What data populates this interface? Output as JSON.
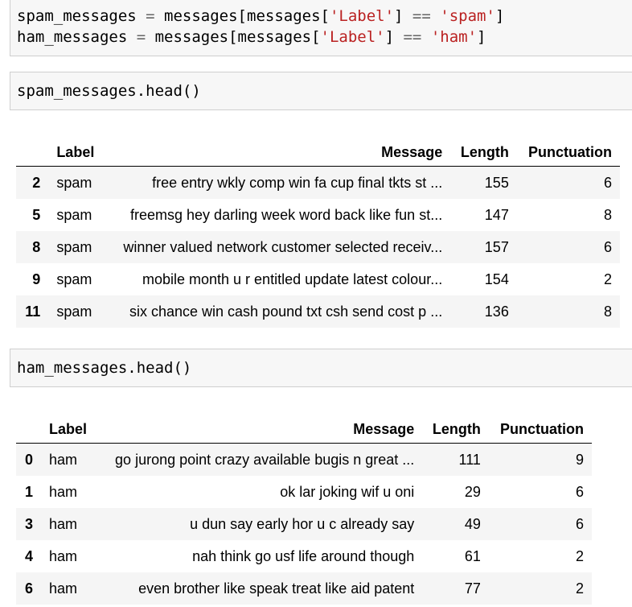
{
  "cells": [
    {
      "lines": [
        [
          [
            "spam_messages ",
            ""
          ],
          [
            "=",
            "o"
          ],
          [
            " messages[messages[",
            ""
          ],
          [
            "'Label'",
            "s"
          ],
          [
            "] ",
            ""
          ],
          [
            "==",
            "o"
          ],
          [
            " ",
            ""
          ],
          [
            "'spam'",
            "s"
          ],
          [
            "]",
            ""
          ]
        ],
        [
          [
            "ham_messages ",
            ""
          ],
          [
            "=",
            "o"
          ],
          [
            " messages[messages[",
            ""
          ],
          [
            "'Label'",
            "s"
          ],
          [
            "] ",
            ""
          ],
          [
            "==",
            "o"
          ],
          [
            " ",
            ""
          ],
          [
            "'ham'",
            "s"
          ],
          [
            "]",
            ""
          ]
        ]
      ]
    },
    {
      "lines": [
        [
          [
            "spam_messages.head()",
            ""
          ]
        ]
      ]
    },
    {
      "lines": [
        [
          [
            "ham_messages.head()",
            ""
          ]
        ]
      ]
    }
  ],
  "spam_table": {
    "columns": [
      "",
      "Label",
      "Message",
      "Length",
      "Punctuation"
    ],
    "rows": [
      [
        "2",
        "spam",
        "free entry wkly comp win fa cup final tkts st ...",
        "155",
        "6"
      ],
      [
        "5",
        "spam",
        "freemsg hey darling week word back like fun st...",
        "147",
        "8"
      ],
      [
        "8",
        "spam",
        "winner valued network customer selected receiv...",
        "157",
        "6"
      ],
      [
        "9",
        "spam",
        "mobile month u r entitled update latest colour...",
        "154",
        "2"
      ],
      [
        "11",
        "spam",
        "six chance win cash pound txt csh send cost p ...",
        "136",
        "8"
      ]
    ]
  },
  "ham_table": {
    "columns": [
      "",
      "Label",
      "Message",
      "Length",
      "Punctuation"
    ],
    "rows": [
      [
        "0",
        "ham",
        "go jurong point crazy available bugis n great ...",
        "111",
        "9"
      ],
      [
        "1",
        "ham",
        "ok lar joking wif u oni",
        "29",
        "6"
      ],
      [
        "3",
        "ham",
        "u dun say early hor u c already say",
        "49",
        "6"
      ],
      [
        "4",
        "ham",
        "nah think go usf life around though",
        "61",
        "2"
      ],
      [
        "6",
        "ham",
        "even brother like speak treat like aid patent",
        "77",
        "2"
      ]
    ]
  }
}
